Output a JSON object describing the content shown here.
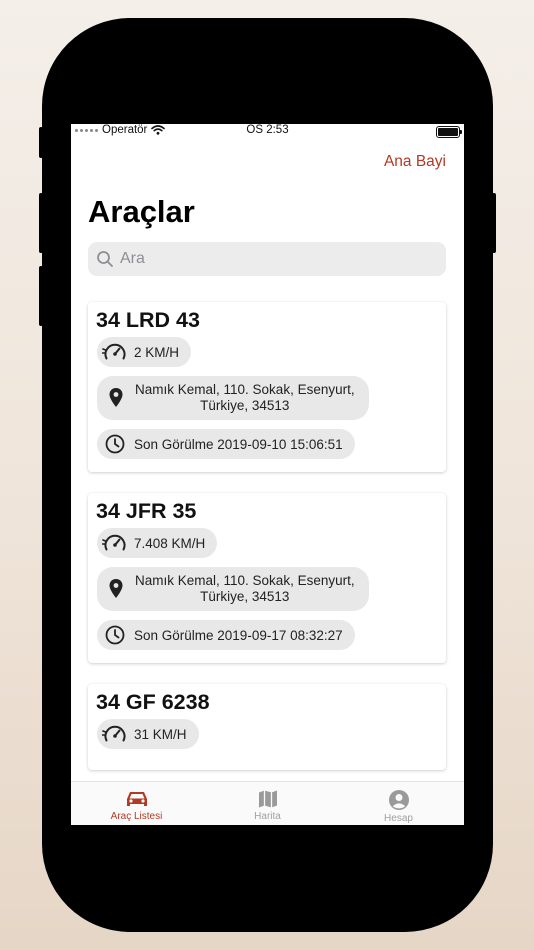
{
  "status_bar": {
    "carrier": "Operatör",
    "time": "ÖS 2:53"
  },
  "nav": {
    "action_label": "Ana Bayi"
  },
  "page": {
    "title": "Araçlar"
  },
  "search": {
    "placeholder": "Ara"
  },
  "vehicles": [
    {
      "plate": "34 LRD 43",
      "speed": "2 KM/H",
      "address_line1": "Namık Kemal, 110. Sokak, Esenyurt,",
      "address_line2": "Türkiye, 34513",
      "last_seen": "Son Görülme 2019-09-10 15:06:51"
    },
    {
      "plate": "34 JFR 35",
      "speed": "7.408 KM/H",
      "address_line1": "Namık Kemal, 110. Sokak, Esenyurt,",
      "address_line2": "Türkiye, 34513",
      "last_seen": "Son Görülme 2019-09-17 08:32:27"
    },
    {
      "plate": "34 GF 6238",
      "speed": "31 KM/H"
    }
  ],
  "tabbar": {
    "items": [
      {
        "label": "Araç Listesi",
        "icon": "car-icon",
        "active": true
      },
      {
        "label": "Harita",
        "icon": "map-icon",
        "active": false
      },
      {
        "label": "Hesap",
        "icon": "account-icon",
        "active": false
      }
    ]
  },
  "colors": {
    "accent": "#b23a25",
    "chip_bg": "#e8e8e8",
    "search_bg": "#ececed",
    "inactive_tab": "#a0a0a0"
  }
}
